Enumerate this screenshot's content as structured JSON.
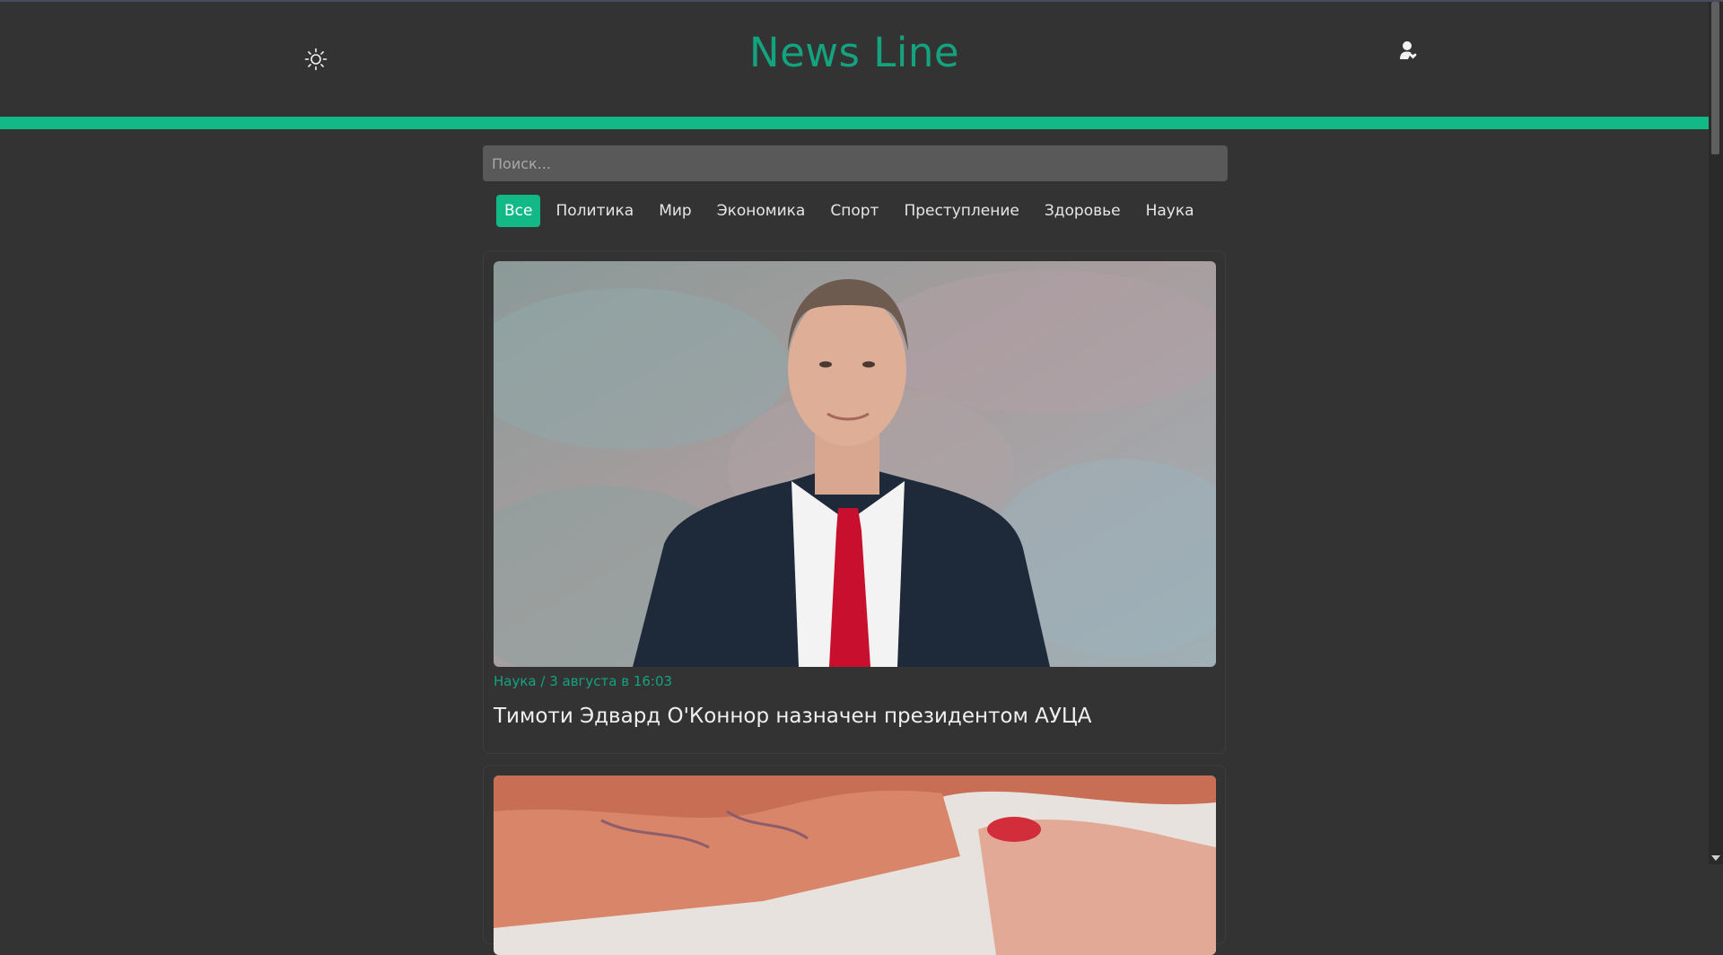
{
  "header": {
    "title": "News Line",
    "theme_icon": "sun-icon",
    "user_icon": "user-heart-icon"
  },
  "colors": {
    "accent": "#12b886",
    "title": "#14a37f",
    "background": "#333333"
  },
  "search": {
    "placeholder": "Поиск...",
    "value": ""
  },
  "categories": [
    {
      "label": "Все",
      "active": true
    },
    {
      "label": "Политика",
      "active": false
    },
    {
      "label": "Мир",
      "active": false
    },
    {
      "label": "Экономика",
      "active": false
    },
    {
      "label": "Спорт",
      "active": false
    },
    {
      "label": "Преступление",
      "active": false
    },
    {
      "label": "Здоровье",
      "active": false
    },
    {
      "label": "Наука",
      "active": false
    }
  ],
  "articles": [
    {
      "meta": "Наука / 3 августа в 16:03",
      "title": "Тимоти Эдвард О'Коннор назначен президентом АУЦА"
    }
  ]
}
